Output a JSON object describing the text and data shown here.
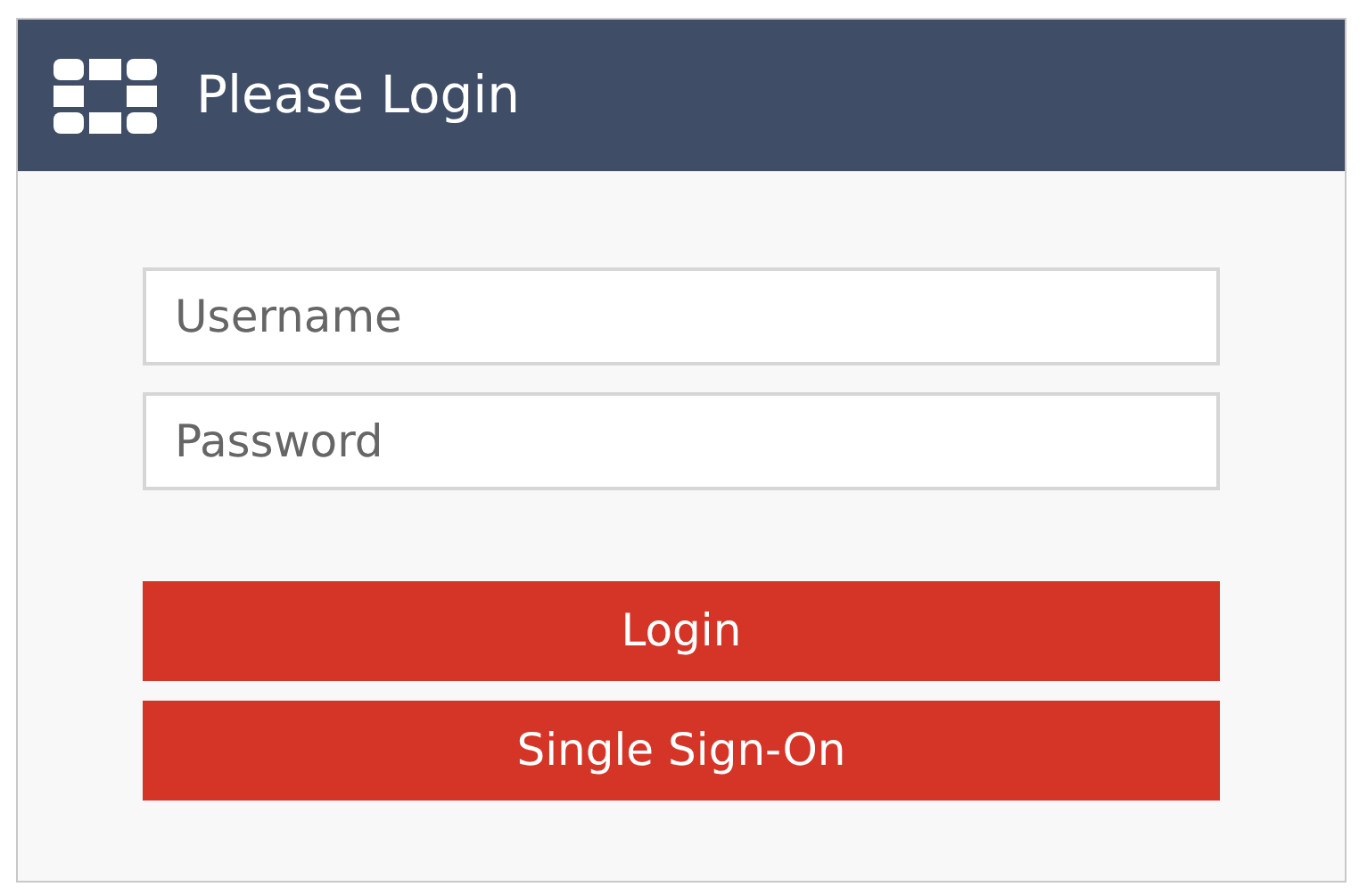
{
  "header": {
    "title": "Please Login"
  },
  "fields": [
    {
      "placeholder": "Username"
    },
    {
      "placeholder": "Password"
    }
  ],
  "buttons": [
    {
      "label": "Login"
    },
    {
      "label": "Single Sign-On"
    }
  ]
}
